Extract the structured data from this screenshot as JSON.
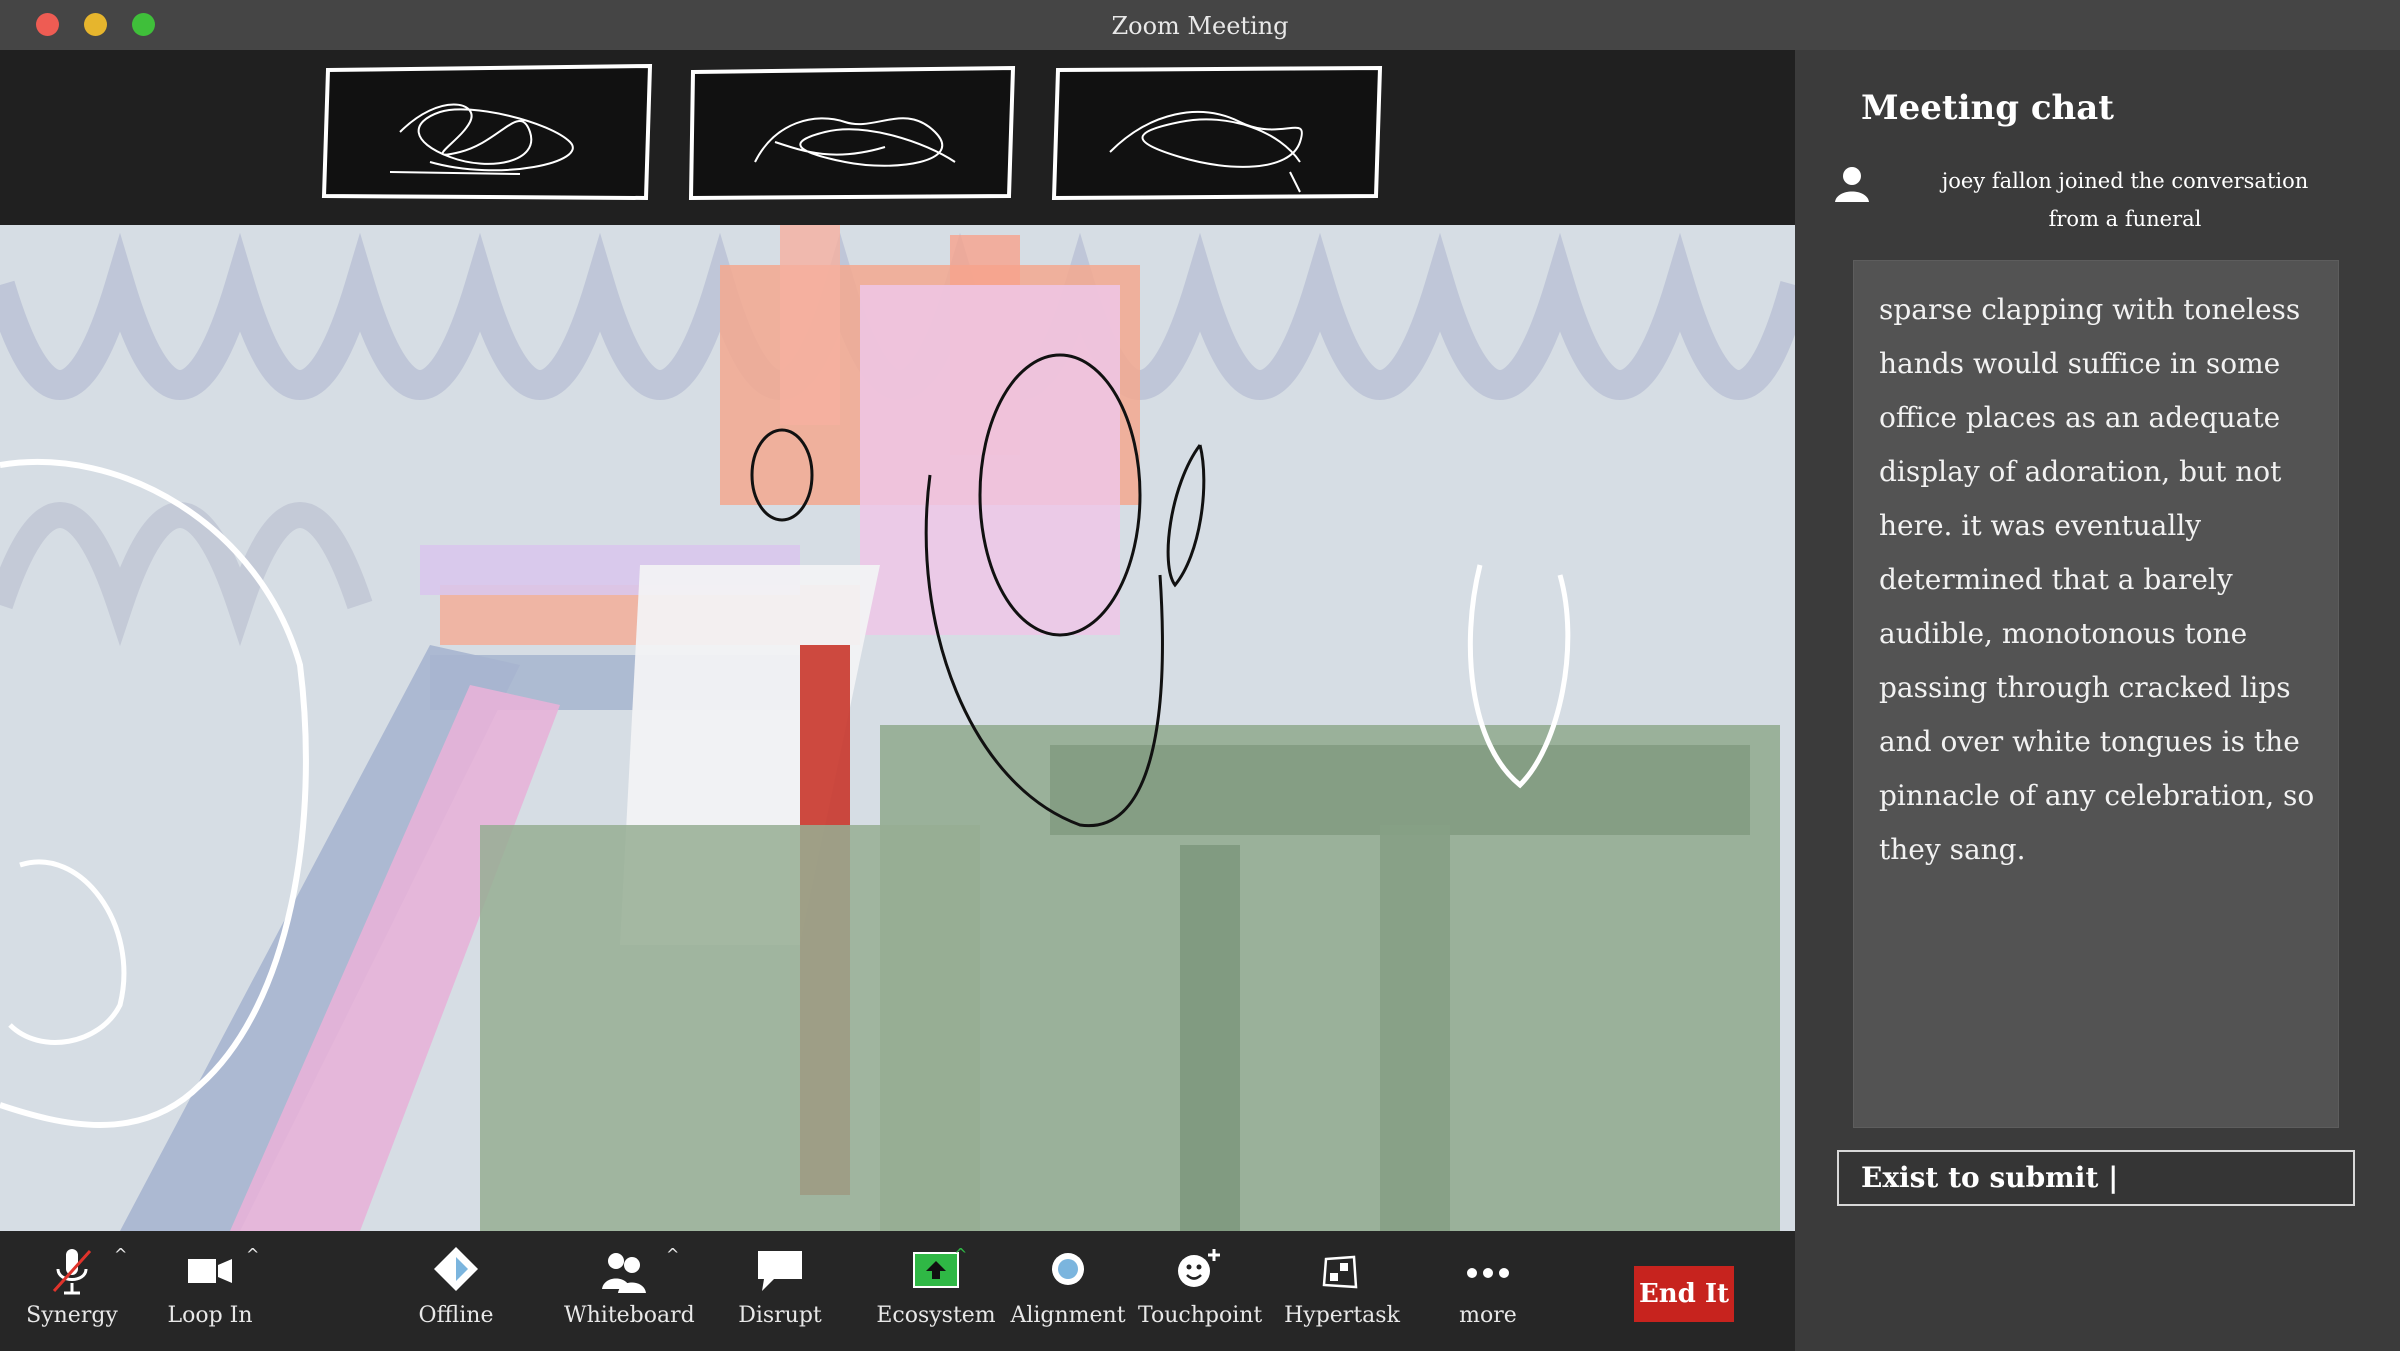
{
  "window": {
    "title": "Zoom Meeting"
  },
  "chat": {
    "title": "Meeting chat",
    "join_line1": "joey fallon  joined the conversation",
    "join_line2": "from a funeral",
    "message": "sparse clapping with toneless hands would suffice in some office places as an adequate display of adoration, but not here. it was eventually determined that a barely audible, monotonous tone passing through cracked lips and over white tongues is the pinnacle of any celebration, so they sang.",
    "input_value": "Exist to submit |"
  },
  "toolbar": {
    "items": [
      {
        "label": "Synergy",
        "icon": "muted-microphone-icon"
      },
      {
        "label": "Loop In",
        "icon": "video-camera-icon"
      },
      {
        "label": "Offline",
        "icon": "diamond-icon"
      },
      {
        "label": "Whiteboard",
        "icon": "participants-icon"
      },
      {
        "label": "Disrupt",
        "icon": "speech-bubble-icon"
      },
      {
        "label": "Ecosystem",
        "icon": "share-screen-icon"
      },
      {
        "label": "Alignment",
        "icon": "record-icon"
      },
      {
        "label": "Touchpoint",
        "icon": "smiley-plus-icon"
      },
      {
        "label": "Hypertask",
        "icon": "apps-icon"
      },
      {
        "label": "more",
        "icon": "more-dots-icon"
      }
    ],
    "end_label": "End It"
  },
  "colors": {
    "end_button": "#c7231e",
    "share_green": "#2fb845",
    "toolbar_bg": "#262626",
    "chat_bg": "#3b3b3b"
  }
}
